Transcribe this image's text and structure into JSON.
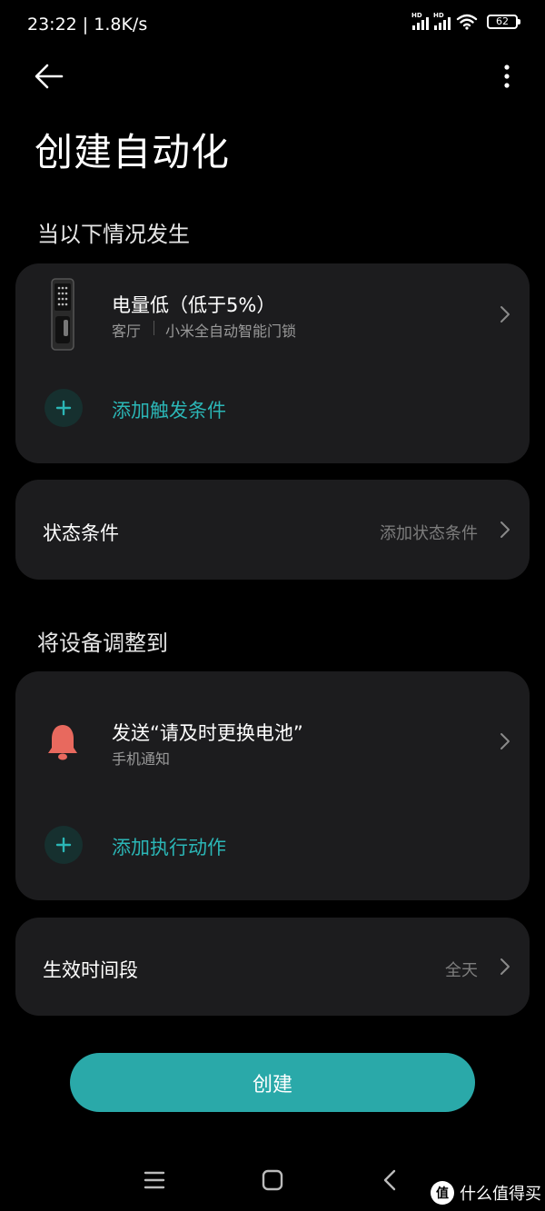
{
  "status_bar": {
    "time": "23:22 | 1.8K/s",
    "signal1_label": "HD",
    "signal2_label": "HD",
    "battery": "62"
  },
  "header": {
    "back_icon": "arrow-left-icon",
    "more_icon": "more-vertical-icon",
    "title": "创建自动化"
  },
  "trigger_section": {
    "label": "当以下情况发生",
    "condition": {
      "title": "电量低（低于5%）",
      "room": "客厅",
      "device": "小米全自动智能门锁",
      "device_icon": "door-lock-icon"
    },
    "add_label": "添加触发条件"
  },
  "state_condition": {
    "label": "状态条件",
    "hint": "添加状态条件"
  },
  "action_section": {
    "label": "将设备调整到",
    "action": {
      "title": "发送“请及时更换电池”",
      "subtitle": "手机通知",
      "icon": "bell-icon",
      "icon_color": "#e8695e"
    },
    "add_label": "添加执行动作"
  },
  "effective_time": {
    "label": "生效时间段",
    "value": "全天"
  },
  "create_button": {
    "label": "创建",
    "color": "#2aa9a9"
  },
  "accent_color": "#2bb6b6",
  "nav_bar": {
    "menu_icon": "menu-icon",
    "home_icon": "home-square-icon",
    "back_icon": "back-chevron-icon"
  },
  "watermark": {
    "logo": "值",
    "text": "什么值得买"
  }
}
